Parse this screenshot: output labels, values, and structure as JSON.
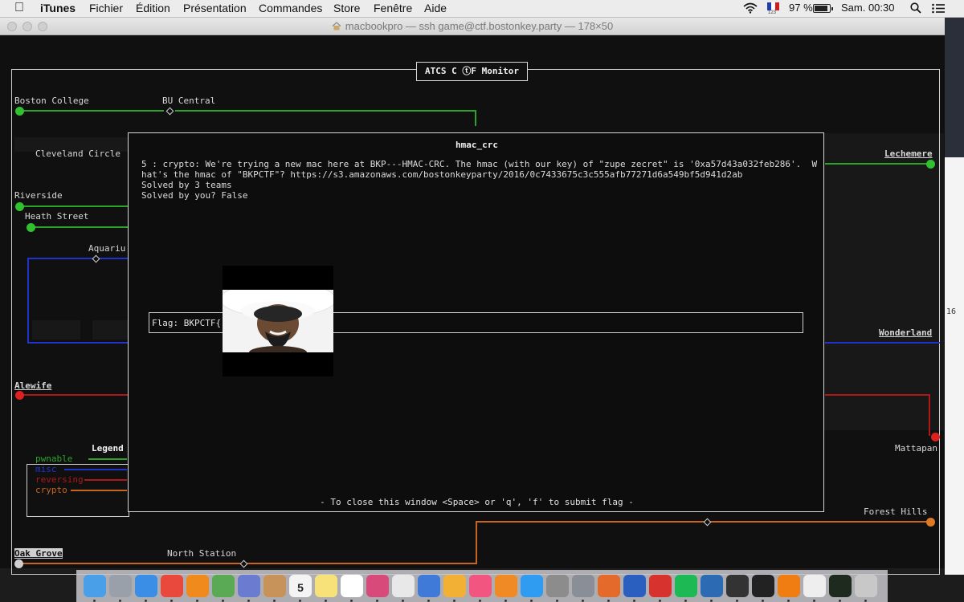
{
  "menubar": {
    "app_name": "iTunes",
    "items": [
      "Fichier",
      "Édition",
      "Présentation",
      "Commandes",
      "Store",
      "Fenêtre",
      "Aide"
    ],
    "battery": "97 %",
    "battery_level": 0.97,
    "datetime": "Sam. 00:30",
    "keyboard_badge": "123",
    "icons": [
      "apple-icon",
      "wifi-icon",
      "french-flag-icon",
      "battery-icon",
      "spotlight-icon",
      "notification-list-icon"
    ]
  },
  "window": {
    "title": "macbookpro — ssh game@ctf.bostonkey.party — 178×50"
  },
  "app": {
    "title": "ATCS C ⓣF Monitor",
    "stations": {
      "boston_college": "Boston College",
      "bu_central": "BU Central",
      "cleveland_circle": "Cleveland Circle",
      "riverside": "Riverside",
      "heath_street": "Heath Street",
      "aquarium": "Aquariu",
      "alewife": "Alewife",
      "oak_grove": "Oak Grove",
      "north_station": "North Station",
      "lechemere": "Lechemere",
      "wonderland": "Wonderland",
      "mattapan": "Mattapan",
      "forest_hills": "Forest Hills"
    },
    "legend": {
      "title": "Legend",
      "items": [
        {
          "label": "pwnable",
          "color": "#2aa52a"
        },
        {
          "label": "misc",
          "color": "#2233cc"
        },
        {
          "label": "reversing",
          "color": "#b01818"
        },
        {
          "label": "crypto",
          "color": "#c8641e"
        }
      ]
    }
  },
  "modal": {
    "title": "hmac_crc",
    "description_line1": "5 : crypto: We're trying a new mac here at BKP---HMAC-CRC. The hmac (with our key) of \"zupe zecret\" is '0xa57d43a032feb286'.  W",
    "description_line2": "hat's the hmac of \"BKPCTF\"? https://s3.amazonaws.com/bostonkeyparty/2016/0c7433675c3c555afb77271d6a549bf5d941d2ab",
    "solved_by": "Solved by 3 teams",
    "solved_by_you": "Solved by you? False",
    "flag_value": "Flag: BKPCTF{",
    "footer": "- To close this window <Space> or 'q', 'f' to submit flag -"
  },
  "side": {
    "number": "16"
  },
  "dock": {
    "apps": [
      "finder-icon",
      "launchpad-icon",
      "safari-icon",
      "chrome-icon",
      "firefox-icon",
      "maps-icon",
      "preview-icon",
      "contacts-icon",
      "calendar-icon",
      "notes-icon",
      "reminders-icon",
      "photo-booth-icon",
      "textedit-icon",
      "keynote-icon",
      "photos-icon",
      "itunes-icon",
      "ibooks-icon",
      "app-store-icon",
      "image-capture-icon",
      "system-preferences-icon",
      "feed-icon",
      "word-icon",
      "wps-icon",
      "spotify-icon",
      "virtualbox-icon",
      "tux-icon",
      "terminal-icon",
      "vlc-icon",
      "keyboard-icon",
      "console-icon",
      "trash-icon"
    ],
    "calendar_day": "5"
  }
}
